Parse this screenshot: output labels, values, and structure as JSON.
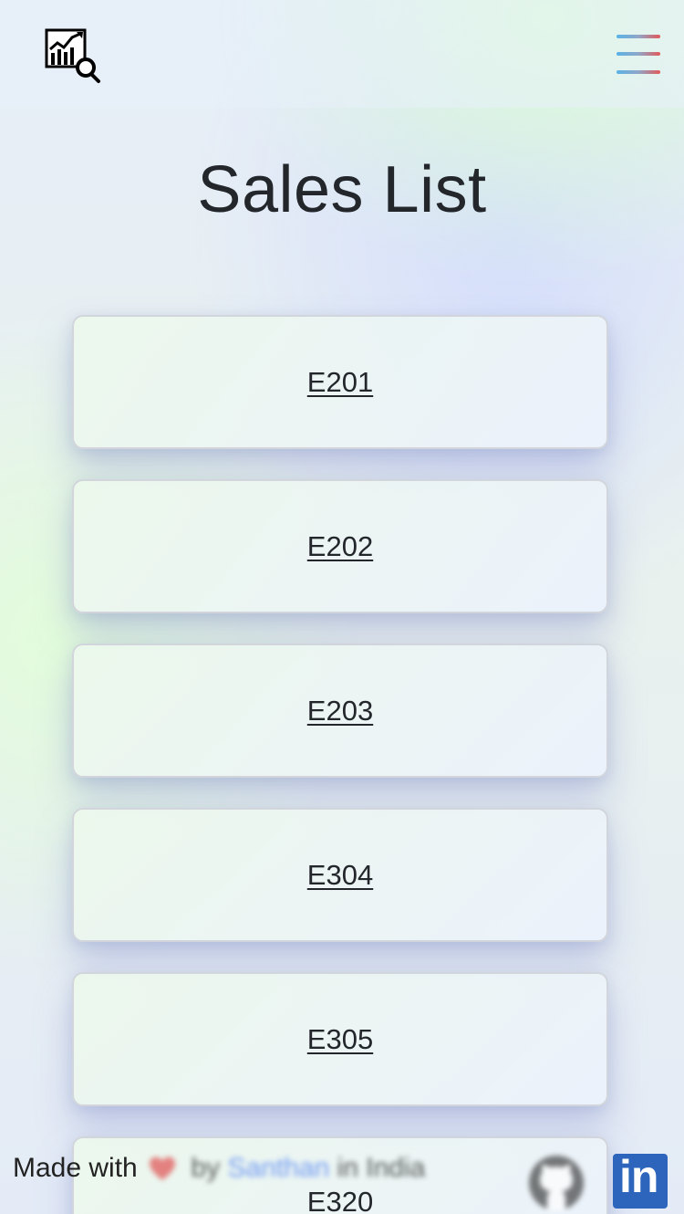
{
  "navbar": {
    "logo_icon": "chart-magnifier-icon",
    "menu_icon": "hamburger-menu-icon",
    "menu_gradient": [
      "#5ab2e6",
      "#e25a5a"
    ]
  },
  "page": {
    "title": "Sales List"
  },
  "sales": [
    {
      "label": "E201"
    },
    {
      "label": "E202"
    },
    {
      "label": "E203"
    },
    {
      "label": "E304"
    },
    {
      "label": "E305"
    },
    {
      "label": "E320"
    }
  ],
  "footer": {
    "made_with": "Made with",
    "heart_icon": "heart-icon",
    "by": "by",
    "author": "Santhan",
    "location": "in India",
    "github_icon": "github-icon",
    "linkedin_icon": "linkedin-icon",
    "linkedin_label": "in",
    "linkedin_color": "#2d64bc",
    "author_color": "#4a7cf2"
  }
}
